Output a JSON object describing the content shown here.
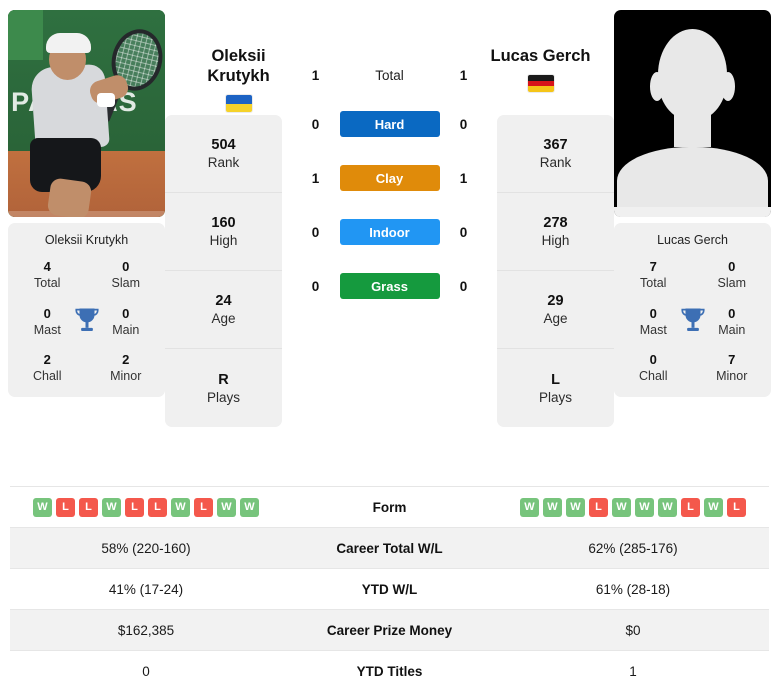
{
  "players": {
    "left": {
      "name": "Oleksii Krutykh",
      "name_line1": "Oleksii",
      "name_line2": "Krutykh",
      "country": "Ukraine",
      "flag_colors": [
        "#1d63c4",
        "#f5d22a"
      ],
      "photo_kind": "action-photo",
      "photo_sponsor_text": "PARIBAS",
      "stats": [
        {
          "value": "504",
          "label": "Rank"
        },
        {
          "value": "160",
          "label": "High"
        },
        {
          "value": "24",
          "label": "Age"
        },
        {
          "value": "R",
          "label": "Plays"
        }
      ],
      "titles": [
        {
          "value": "4",
          "label": "Total"
        },
        {
          "value": "0",
          "label": "Slam"
        },
        {
          "value": "0",
          "label": "Mast"
        },
        {
          "value": "0",
          "label": "Main"
        },
        {
          "value": "2",
          "label": "Chall"
        },
        {
          "value": "2",
          "label": "Minor"
        }
      ],
      "form": [
        "W",
        "L",
        "L",
        "W",
        "L",
        "L",
        "W",
        "L",
        "W",
        "W"
      ],
      "career_total_wl": "58% (220-160)",
      "ytd_wl": "41% (17-24)",
      "career_prize_money": "$162,385",
      "ytd_titles": "0"
    },
    "right": {
      "name": "Lucas Gerch",
      "name_line1": "Lucas Gerch",
      "name_line2": "",
      "country": "Germany",
      "flag_colors": [
        "#1a1a1a",
        "#d7141a",
        "#f5c518"
      ],
      "photo_kind": "placeholder-silhouette",
      "photo_sponsor_text": "",
      "stats": [
        {
          "value": "367",
          "label": "Rank"
        },
        {
          "value": "278",
          "label": "High"
        },
        {
          "value": "29",
          "label": "Age"
        },
        {
          "value": "L",
          "label": "Plays"
        }
      ],
      "titles": [
        {
          "value": "7",
          "label": "Total"
        },
        {
          "value": "0",
          "label": "Slam"
        },
        {
          "value": "0",
          "label": "Mast"
        },
        {
          "value": "0",
          "label": "Main"
        },
        {
          "value": "0",
          "label": "Chall"
        },
        {
          "value": "7",
          "label": "Minor"
        }
      ],
      "form": [
        "W",
        "W",
        "W",
        "L",
        "W",
        "W",
        "W",
        "L",
        "W",
        "L"
      ],
      "career_total_wl": "62% (285-176)",
      "ytd_wl": "61% (28-18)",
      "career_prize_money": "$0",
      "ytd_titles": "1"
    }
  },
  "head_to_head": {
    "total": {
      "label": "Total",
      "left": "1",
      "right": "1"
    },
    "surfaces": [
      {
        "label": "Hard",
        "color": "#0a69c2",
        "left": "0",
        "right": "0"
      },
      {
        "label": "Clay",
        "color": "#e08b0a",
        "left": "1",
        "right": "1"
      },
      {
        "label": "Indoor",
        "color": "#2196f3",
        "left": "0",
        "right": "0"
      },
      {
        "label": "Grass",
        "color": "#159a3e",
        "left": "0",
        "right": "0"
      }
    ]
  },
  "table": {
    "rows": [
      {
        "label": "Form",
        "type": "form"
      },
      {
        "label": "Career Total W/L",
        "type": "text",
        "left": "58% (220-160)",
        "right": "62% (285-176)"
      },
      {
        "label": "YTD W/L",
        "type": "text",
        "left": "41% (17-24)",
        "right": "61% (28-18)"
      },
      {
        "label": "Career Prize Money",
        "type": "text",
        "left": "$162,385",
        "right": "$0"
      },
      {
        "label": "YTD Titles",
        "type": "text",
        "left": "0",
        "right": "1"
      }
    ]
  },
  "colors": {
    "win_badge": "#77c47c",
    "loss_badge": "#f4584c",
    "card_bg": "#f0f0f0",
    "row_shaded": "#f2f2f2",
    "trophy": "#3d6fb4"
  }
}
